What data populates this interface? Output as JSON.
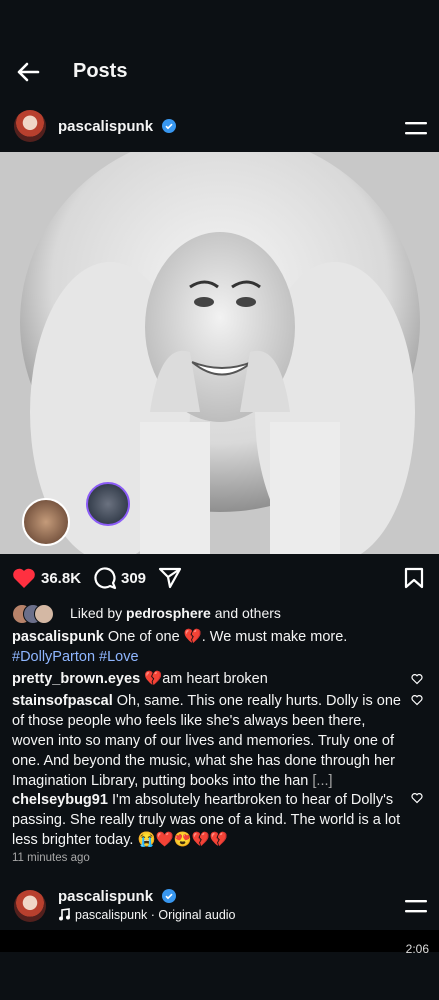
{
  "header": {
    "title": "Posts"
  },
  "post": {
    "username": "pascalispunk",
    "likes": "36.8K",
    "comments": "309",
    "liked_by_prefix": "Liked by",
    "liked_by_user": "pedrosphere",
    "liked_by_suffix": "and others",
    "caption_user": "pascalispunk",
    "caption_text": "One of one 💔. We must make more.",
    "hashtags": "#DollyParton #Love",
    "comments_list": [
      {
        "user": "pretty_brown.eyes",
        "text": "💔am heart  broken"
      },
      {
        "user": "stainsofpascal",
        "text": "Oh, same. This one really hurts. Dolly is one of those people who feels like she's always been there, woven into so many of our lives and memories. Truly one of one. And beyond the music, what she has done through her Imagination Library, putting books into the han",
        "more": "[...]"
      },
      {
        "user": "chelseybug91",
        "text": "I'm absolutely heartbroken to hear of Dolly's passing. She really truly was one of a kind. The world is a lot less brighter today. 😭❤️😍💔💔"
      }
    ],
    "timestamp": "11 minutes ago"
  },
  "next_post": {
    "username": "pascalispunk",
    "audio": "pascalispunk · Original audio"
  },
  "status": {
    "time": "2:06"
  },
  "colors": {
    "like_red": "#ff3040",
    "verified_blue": "#3897f0"
  }
}
